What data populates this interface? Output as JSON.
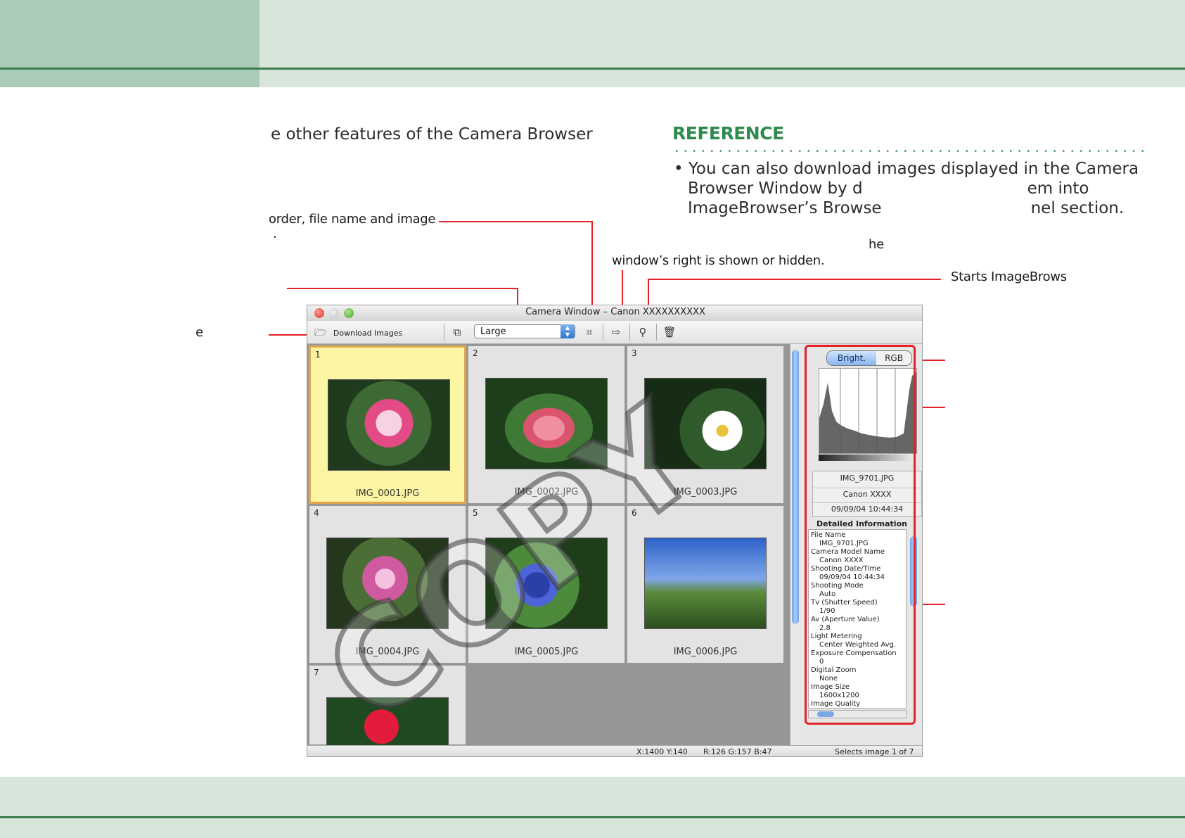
{
  "intro_text": "e other features of the Camera Browser",
  "reference": {
    "title": "REFERENCE",
    "lines": [
      "• You can also download images displayed in the Camera",
      "Browser Window by d                                em into",
      "ImageBrowser’s Browse                             nel section."
    ]
  },
  "callouts": {
    "sort_order_line1": "order, file name and image",
    "sort_order_line2": ".",
    "panel_toggle_line1": "he",
    "panel_toggle_line2": "window’s right is shown or hidden.",
    "starts_imagebrowser": "Starts ImageBrows",
    "left_letter": "e"
  },
  "window": {
    "title": "Camera Window – Canon XXXXXXXXXX",
    "download_label": "Download Images",
    "size_select_value": "Large",
    "thumbnails": [
      {
        "num": "1",
        "name": "IMG_0001.JPG",
        "selected": true
      },
      {
        "num": "2",
        "name": "IMG_0002.JPG",
        "selected": false
      },
      {
        "num": "3",
        "name": "IMG_0003.JPG",
        "selected": false
      },
      {
        "num": "4",
        "name": "IMG_0004.JPG",
        "selected": false
      },
      {
        "num": "5",
        "name": "IMG_0005.JPG",
        "selected": false
      },
      {
        "num": "6",
        "name": "IMG_0006.JPG",
        "selected": false
      },
      {
        "num": "7",
        "name": "",
        "selected": false
      }
    ],
    "histogram_tabs": [
      "Bright.",
      "RGB"
    ],
    "info_summary": [
      "IMG_9701.JPG",
      "Canon XXXX",
      "09/09/04 10:44:34"
    ],
    "detailed_title": "Detailed Information",
    "detailed_info": [
      {
        "label": "File Name",
        "value": "IMG_9701.JPG"
      },
      {
        "label": "Camera Model Name",
        "value": "Canon XXXX"
      },
      {
        "label": "Shooting Date/Time",
        "value": "09/09/04 10:44:34"
      },
      {
        "label": "Shooting Mode",
        "value": "Auto"
      },
      {
        "label": "Tv (Shutter Speed)",
        "value": "1/90"
      },
      {
        "label": "Av (Aperture Value)",
        "value": "2.8"
      },
      {
        "label": "Light Metering",
        "value": "Center Weighted Avg."
      },
      {
        "label": "Exposure Compensation",
        "value": "0"
      },
      {
        "label": "Digital Zoom",
        "value": "None"
      },
      {
        "label": "Image Size",
        "value": "1600x1200"
      },
      {
        "label": "Image Quality",
        "value": ""
      }
    ],
    "status": {
      "coords": "X:1400 Y:140",
      "rgb": "R:126 G:157 B:47",
      "selection": "Selects image 1 of 7"
    }
  },
  "watermark": "COPY",
  "colors": {
    "accent_green": "#2f8a4e",
    "callout_red": "#e62129",
    "header_dark": "#abcbb6",
    "header_light": "#d7e5db"
  }
}
